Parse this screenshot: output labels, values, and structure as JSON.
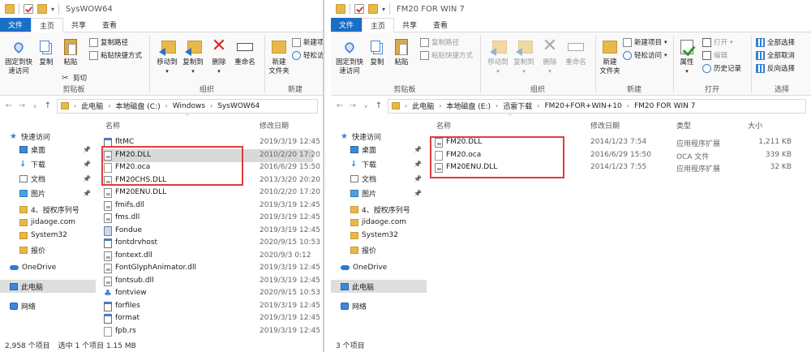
{
  "left": {
    "title": "SysWOW64",
    "tabs": [
      "文件",
      "主页",
      "共享",
      "查看"
    ],
    "ribbon": {
      "pin": "固定到快\n速访问",
      "copy": "复制",
      "paste": "粘贴",
      "copy_path": "复制路径",
      "paste_shortcut": "粘贴快捷方式",
      "cut": "剪切",
      "clipboard": "剪贴板",
      "move_to": "移动到",
      "copy_to": "复制到",
      "delete": "删除",
      "rename": "重命名",
      "organize": "组织",
      "new_folder": "新建\n文件夹",
      "new_item": "新建项目",
      "easy_access": "轻松访问",
      "new_group": "新建"
    },
    "breadcrumb": [
      "此电脑",
      "本地磁盘 (C:)",
      "Windows",
      "SysWOW64"
    ],
    "nav": [
      {
        "label": "快速访问",
        "icon": "star-icon"
      },
      {
        "label": "桌面",
        "icon": "desktop-icon",
        "pinned": true
      },
      {
        "label": "下载",
        "icon": "download-icon",
        "pinned": true
      },
      {
        "label": "文档",
        "icon": "document-icon",
        "pinned": true
      },
      {
        "label": "图片",
        "icon": "pictures-icon",
        "pinned": true
      },
      {
        "label": "4、授权序列号",
        "icon": "folder-icon"
      },
      {
        "label": "jidaoge.com",
        "icon": "folder-icon"
      },
      {
        "label": "System32",
        "icon": "folder-icon"
      },
      {
        "label": "报价",
        "icon": "folder-icon"
      },
      {
        "label": "OneDrive",
        "icon": "onedrive-icon"
      },
      {
        "label": "此电脑",
        "icon": "computer-icon",
        "selected": true
      },
      {
        "label": "网络",
        "icon": "network-icon"
      }
    ],
    "columns": {
      "name": "名称",
      "date": "修改日期"
    },
    "files": [
      {
        "name": "fltMC",
        "date": "2019/3/19 12:45",
        "icon": "exe"
      },
      {
        "name": "FM20.DLL",
        "date": "2010/2/20 17:20",
        "icon": "dll",
        "selected": true
      },
      {
        "name": "FM20.oca",
        "date": "2016/6/29 15:50",
        "icon": "blank"
      },
      {
        "name": "FM20CHS.DLL",
        "date": "2013/3/20 20:20",
        "icon": "dll"
      },
      {
        "name": "FM20ENU.DLL",
        "date": "2010/2/20 17:20",
        "icon": "dll"
      },
      {
        "name": "fmifs.dll",
        "date": "2019/3/19 12:45",
        "icon": "dll"
      },
      {
        "name": "fms.dll",
        "date": "2019/3/19 12:45",
        "icon": "dll"
      },
      {
        "name": "Fondue",
        "date": "2019/3/19 12:45",
        "icon": "gear"
      },
      {
        "name": "fontdrvhost",
        "date": "2020/9/15 10:53",
        "icon": "exe"
      },
      {
        "name": "fontext.dll",
        "date": "2020/9/3 0:12",
        "icon": "dll"
      },
      {
        "name": "FontGlyphAnimator.dll",
        "date": "2019/3/19 12:45",
        "icon": "dll"
      },
      {
        "name": "fontsub.dll",
        "date": "2019/3/19 12:45",
        "icon": "dll"
      },
      {
        "name": "fontview",
        "date": "2020/9/15 10:53",
        "icon": "fontview"
      },
      {
        "name": "forfiles",
        "date": "2019/3/19 12:45",
        "icon": "exe"
      },
      {
        "name": "format",
        "date": "2019/3/19 12:45",
        "icon": "exe"
      },
      {
        "name": "fpb.rs",
        "date": "2019/3/19 12:45",
        "icon": "blank"
      }
    ],
    "status": {
      "count": "2,958 个项目",
      "selection": "选中 1 个项目  1.15 MB"
    }
  },
  "right": {
    "title": "FM20 FOR WIN 7",
    "tabs": [
      "文件",
      "主页",
      "共享",
      "查看"
    ],
    "ribbon": {
      "pin": "固定到快\n速访问",
      "copy": "复制",
      "paste": "粘贴",
      "copy_path": "复制路径",
      "paste_shortcut": "粘贴快捷方式",
      "clipboard": "剪贴板",
      "move_to": "移动到",
      "copy_to": "复制到",
      "delete": "删除",
      "rename": "重命名",
      "organize": "组织",
      "new_folder": "新建\n文件夹",
      "new_item": "新建项目",
      "easy_access": "轻松访问",
      "new_group": "新建",
      "properties": "属性",
      "open": "打开",
      "edit": "编辑",
      "history": "历史记录",
      "open_group": "打开",
      "select_all": "全部选择",
      "select_none": "全部取消",
      "invert": "反向选择",
      "select_group": "选择"
    },
    "breadcrumb": [
      "此电脑",
      "本地磁盘 (E:)",
      "迅雷下载",
      "FM20+FOR+WIN+10",
      "FM20 FOR WIN 7"
    ],
    "nav": [
      {
        "label": "快速访问",
        "icon": "star-icon"
      },
      {
        "label": "桌面",
        "icon": "desktop-icon",
        "pinned": true
      },
      {
        "label": "下载",
        "icon": "download-icon",
        "pinned": true
      },
      {
        "label": "文档",
        "icon": "document-icon",
        "pinned": true
      },
      {
        "label": "图片",
        "icon": "pictures-icon",
        "pinned": true
      },
      {
        "label": "4、授权序列号",
        "icon": "folder-icon"
      },
      {
        "label": "jidaoge.com",
        "icon": "folder-icon"
      },
      {
        "label": "System32",
        "icon": "folder-icon"
      },
      {
        "label": "报价",
        "icon": "folder-icon"
      },
      {
        "label": "OneDrive",
        "icon": "onedrive-icon"
      },
      {
        "label": "此电脑",
        "icon": "computer-icon",
        "selected": true
      },
      {
        "label": "网络",
        "icon": "network-icon"
      }
    ],
    "columns": {
      "name": "名称",
      "date": "修改日期",
      "type": "类型",
      "size": "大小"
    },
    "files": [
      {
        "name": "FM20.DLL",
        "date": "2014/1/23 7:54",
        "type": "应用程序扩展",
        "size": "1,211 KB",
        "icon": "dll"
      },
      {
        "name": "FM20.oca",
        "date": "2016/6/29 15:50",
        "type": "OCA 文件",
        "size": "339 KB",
        "icon": "blank"
      },
      {
        "name": "FM20ENU.DLL",
        "date": "2014/1/23 7:55",
        "type": "应用程序扩展",
        "size": "32 KB",
        "icon": "dll"
      }
    ],
    "status": {
      "count": "3 个项目"
    }
  },
  "colors": {
    "accent": "#1a6ec6",
    "highlight_box": "#e03c3c",
    "folder": "#e8b94a"
  }
}
